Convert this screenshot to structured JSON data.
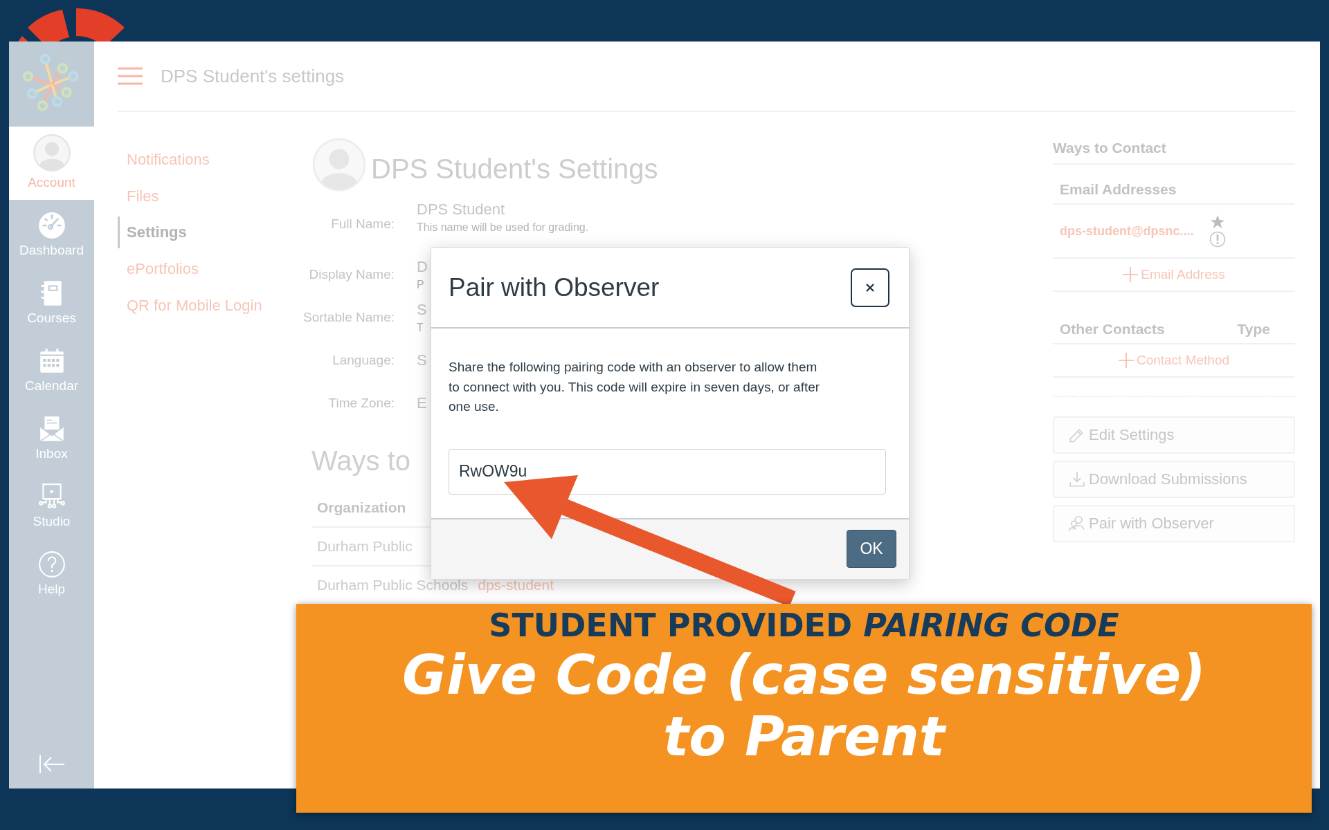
{
  "sidebar": {
    "items": [
      {
        "kind": "account",
        "label": "Account",
        "selected": true
      },
      {
        "kind": "dashboard",
        "label": "Dashboard",
        "selected": false
      },
      {
        "kind": "courses",
        "label": "Courses",
        "selected": false
      },
      {
        "kind": "calendar",
        "label": "Calendar",
        "selected": false
      },
      {
        "kind": "inbox",
        "label": "Inbox",
        "selected": false
      },
      {
        "kind": "studio",
        "label": "Studio",
        "selected": false
      },
      {
        "kind": "help",
        "label": "Help",
        "selected": false
      }
    ]
  },
  "header": {
    "title": "DPS Student's settings"
  },
  "nav": [
    {
      "label": "Notifications",
      "selected": false
    },
    {
      "label": "Files",
      "selected": false
    },
    {
      "label": "Settings",
      "selected": true
    },
    {
      "label": "ePortfolios",
      "selected": false
    },
    {
      "label": "QR for Mobile Login",
      "selected": false
    }
  ],
  "profile": {
    "title": "DPS Student's Settings",
    "fields": [
      {
        "label": "Full Name:",
        "value": "DPS Student",
        "hint": "This name will be used for grading."
      },
      {
        "label": "Display Name:",
        "value": "D",
        "hint": "P"
      },
      {
        "label": "Sortable Name:",
        "value": "S",
        "hint": "T"
      },
      {
        "label": "Language:",
        "value": "S"
      },
      {
        "label": "Time Zone:",
        "value": "E"
      }
    ]
  },
  "ways_to": {
    "heading": "Ways to",
    "columns": [
      "Organization"
    ],
    "rows": [
      {
        "organization": "Durham Public"
      },
      {
        "organization": "Durham Public Schools",
        "login": "dps-student"
      }
    ]
  },
  "contact": {
    "title": "Ways to Contact",
    "email_heading": "Email Addresses",
    "emails": [
      {
        "address": "dps-student@dpsnc...."
      }
    ],
    "add_email": "Email Address",
    "other_heading": "Other Contacts",
    "type_heading": "Type",
    "add_contact": "Contact Method"
  },
  "actions": [
    {
      "kind": "edit",
      "label": "Edit Settings"
    },
    {
      "kind": "download",
      "label": "Download Submissions"
    },
    {
      "kind": "pair",
      "label": "Pair with Observer"
    }
  ],
  "modal": {
    "title": "Pair with Observer",
    "message": "Share the following pairing code with an observer to allow them to connect with you. This code will expire in seven days, or after one use.",
    "code": "RwOW9u",
    "ok": "OK"
  },
  "callout": {
    "heading": "STUDENT PROVIDED *PAIRING CODE*",
    "lines": [
      "Give Code (case sensitive)",
      "to Parent"
    ]
  }
}
